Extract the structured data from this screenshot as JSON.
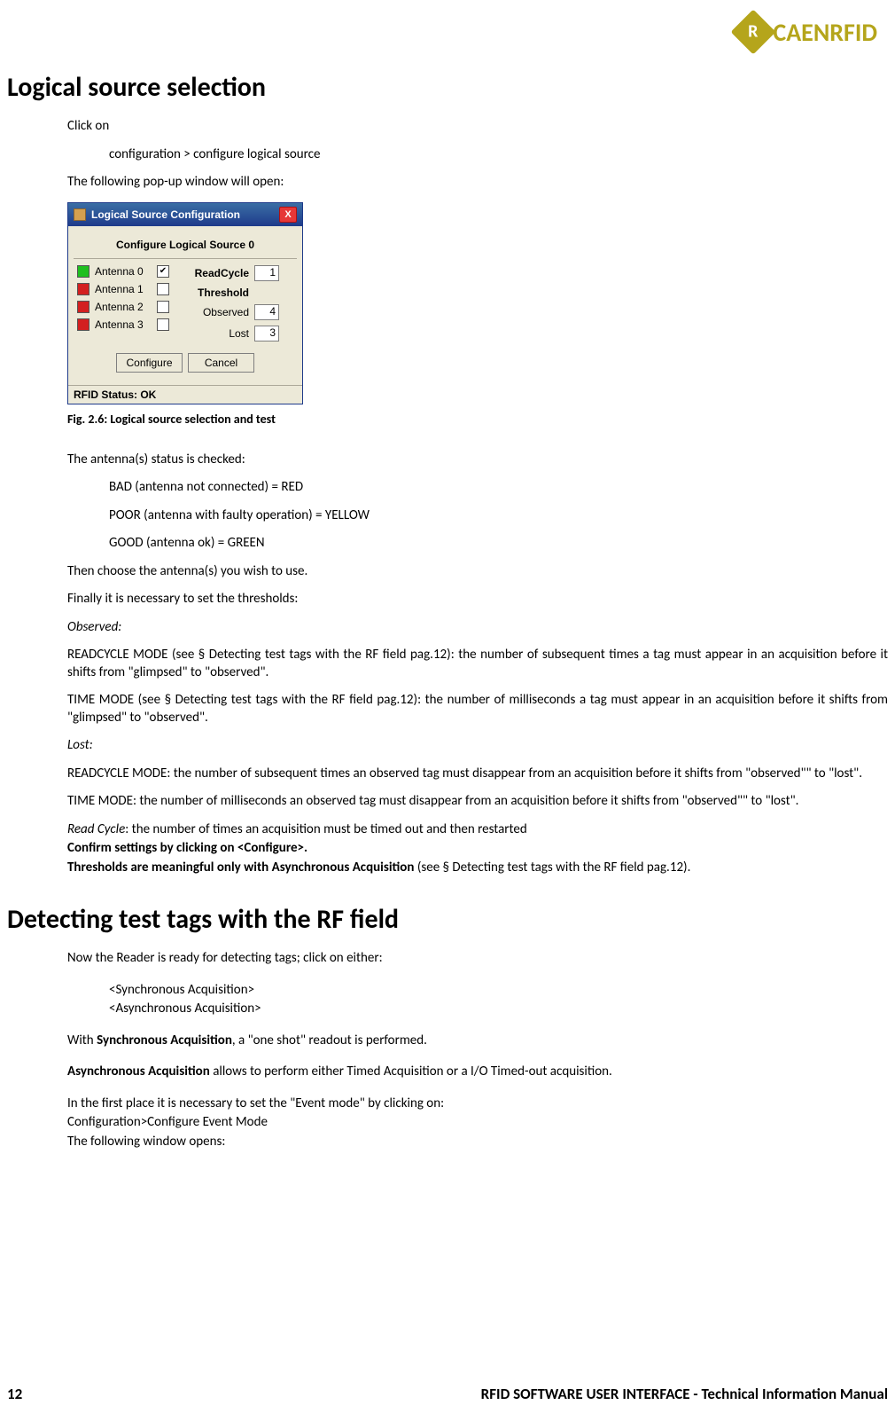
{
  "brand": "CAENRFID",
  "brand_icon_letter": "R",
  "page_number": "12",
  "footer_title": "RFID SOFTWARE USER INTERFACE - Technical Information Manual",
  "section1": {
    "heading": "Logical source selection",
    "p1": "Click on",
    "p2": "configuration > configure logical source",
    "p3": "The following pop-up window will open:",
    "fig_caption": "Fig. 2.6: Logical source selection and test",
    "p4": "The antenna(s) status is checked:",
    "status_lines": [
      "BAD (antenna not connected) = RED",
      "POOR (antenna with faulty operation) = YELLOW",
      "GOOD (antenna ok) = GREEN"
    ],
    "p5": "Then choose the antenna(s) you wish to use.",
    "p6": "Finally it is necessary to set the thresholds:",
    "observed_label": "Observed:",
    "p7": "READCYCLE MODE (see § Detecting test tags with the RF field pag.12): the number of subsequent times a tag must appear in an acquisition before it shifts from \"glimpsed\" to \"observed\".",
    "p8": "TIME MODE (see § Detecting test tags with the RF field pag.12): the number of milliseconds a tag must appear in an acquisition before it shifts from \"glimpsed\" to \"observed\".",
    "lost_label": "Lost:",
    "p9": "READCYCLE MODE: the number of subsequent times an observed tag must disappear from an acquisition before it shifts from \"observed\"\" to \"lost\".",
    "p10": "TIME MODE: the number of milliseconds an observed tag must disappear from an acquisition before it shifts from \"observed\"\" to \"lost\".",
    "p11a": "Read Cycle",
    "p11b": ": the number of times an acquisition must be timed out and then restarted",
    "p12": "Confirm settings by clicking on <Configure>.",
    "p13a": "Thresholds are meaningful only with Asynchronous Acquisition ",
    "p13b": "(see § Detecting test tags with the RF field pag.12)."
  },
  "dialog": {
    "title": "Logical Source Configuration",
    "subheader": "Configure Logical Source 0",
    "antennas": [
      {
        "label": "Antenna 0",
        "color": "green",
        "checked": "✔"
      },
      {
        "label": "Antenna 1",
        "color": "red",
        "checked": ""
      },
      {
        "label": "Antenna 2",
        "color": "red",
        "checked": ""
      },
      {
        "label": "Antenna 3",
        "color": "red",
        "checked": ""
      }
    ],
    "readcycle_label": "ReadCycle",
    "readcycle_value": "1",
    "threshold_label": "Threshold",
    "observed_label": "Observed",
    "observed_value": "4",
    "lost_label": "Lost",
    "lost_value": "3",
    "configure_btn": "Configure",
    "cancel_btn": "Cancel",
    "status_bar": "RFID Status: OK",
    "close_x": "X"
  },
  "section2": {
    "heading": "Detecting test tags with the RF field",
    "p1": "Now the Reader is ready for detecting tags; click on either:",
    "opt1": "<Synchronous Acquisition>",
    "opt2": "<Asynchronous Acquisition>",
    "p2a": "With ",
    "p2b": "Synchronous Acquisition",
    "p2c": ", a \"one shot\" readout is performed.",
    "p3a": "Asynchronous Acquisition",
    "p3b": " allows to perform either Timed Acquisition or a I/O Timed-out acquisition.",
    "p4": "In the first place it is necessary to set the \"Event mode\" by clicking on:",
    "p5": "Configuration>Configure Event Mode",
    "p6": "The following window opens:"
  }
}
